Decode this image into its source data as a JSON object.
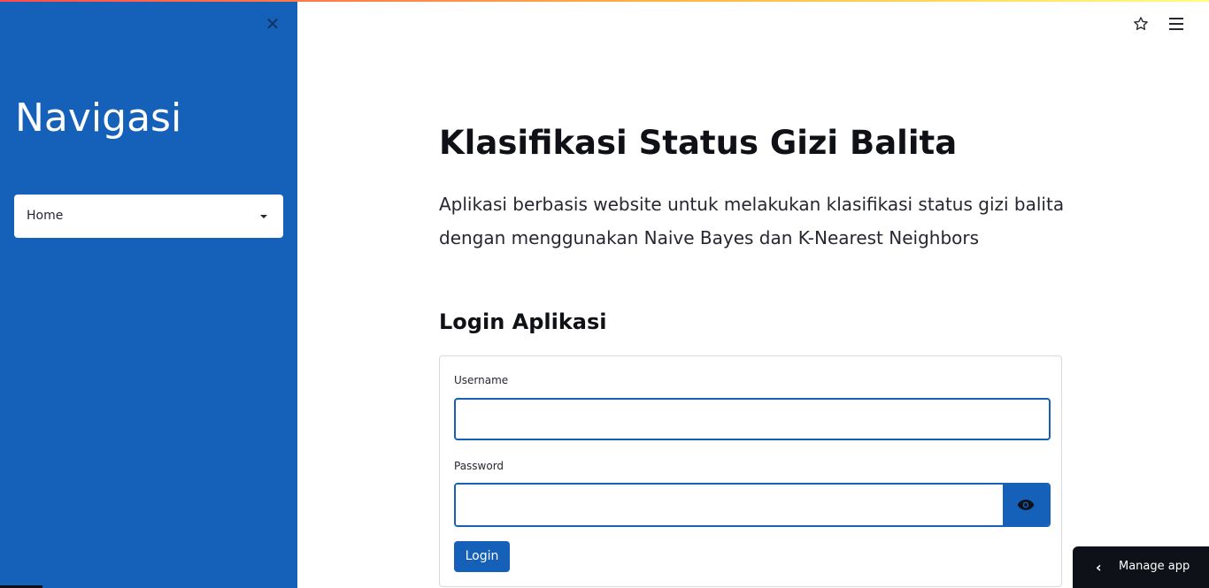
{
  "sidebar": {
    "title": "Navigasi",
    "select": {
      "value": "Home"
    },
    "close_icon": "close-icon"
  },
  "header": {
    "icons": [
      "star-icon",
      "hamburger-menu-icon"
    ]
  },
  "main": {
    "title": "Klasifikasi Status Gizi Balita",
    "description": "Aplikasi berbasis website untuk melakukan klasifikasi status gizi balita dengan menggunakan Naive Bayes dan K-Nearest Neighbors",
    "login": {
      "section_title": "Login Aplikasi",
      "username_label": "Username",
      "username_value": "",
      "password_label": "Password",
      "password_value": "",
      "eye_icon": "eye-icon",
      "button_label": "Login"
    }
  },
  "manage_app": {
    "label": "Manage app",
    "icon": "chevron-left-icon"
  },
  "colors": {
    "sidebar": "#1560b8",
    "primary": "#1560b8",
    "dark": "#0e1117"
  }
}
